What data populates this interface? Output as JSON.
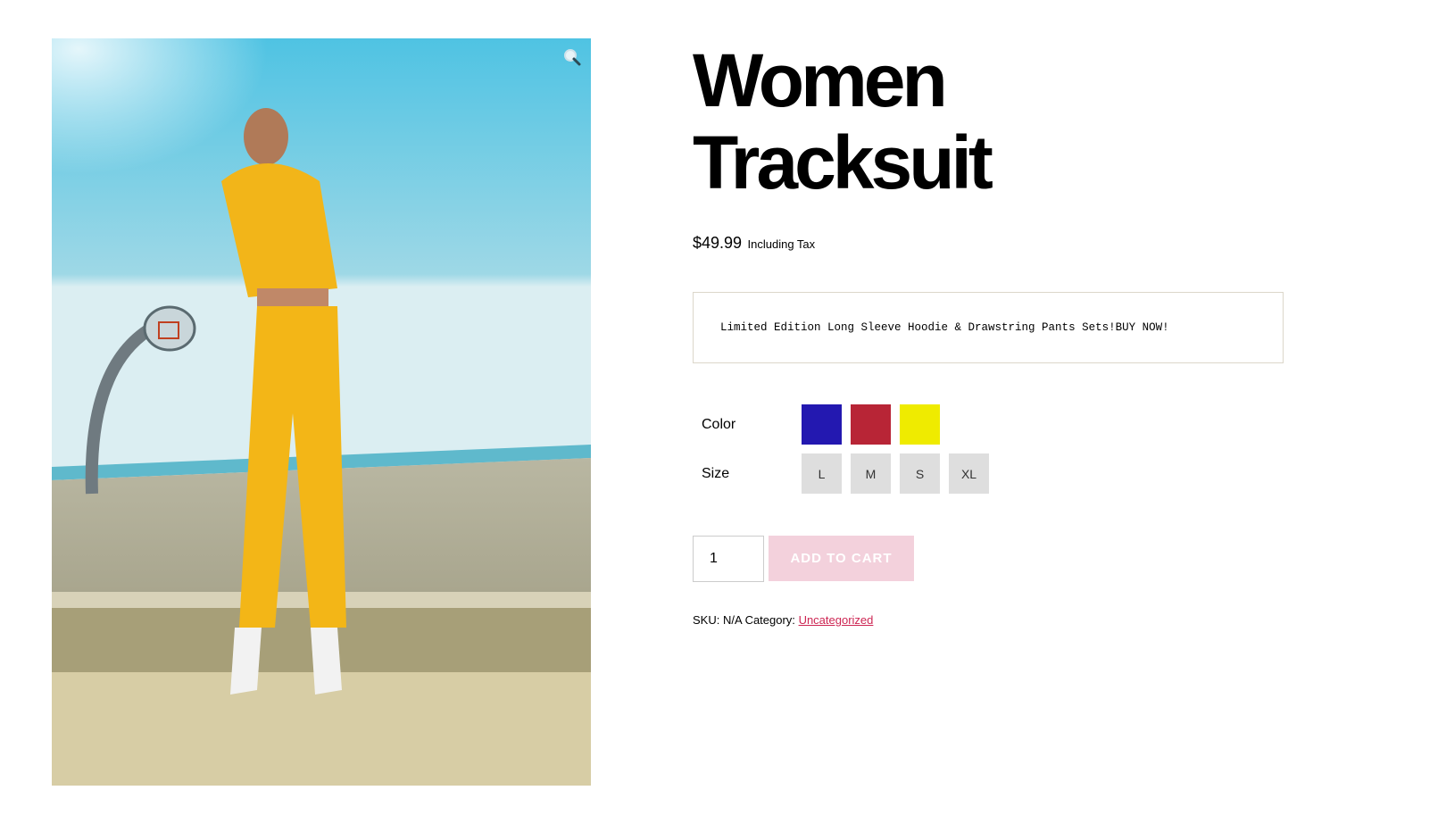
{
  "product": {
    "title_line1": "Women",
    "title_line2": "Tracksuit",
    "price": "$49.99",
    "price_suffix": "Including Tax",
    "short_description": "Limited Edition Long Sleeve Hoodie & Drawstring Pants Sets!BUY NOW!",
    "image_alt": "Woman wearing yellow cropped hoodie and drawstring pants near basketball hoop",
    "zoom_icon": "magnifier-icon"
  },
  "variations": {
    "color_label": "Color",
    "colors": [
      {
        "name": "Blue",
        "hex": "#2318b0"
      },
      {
        "name": "Red",
        "hex": "#b82536"
      },
      {
        "name": "Yellow",
        "hex": "#efeb00"
      }
    ],
    "size_label": "Size",
    "sizes": [
      "L",
      "M",
      "S",
      "XL"
    ]
  },
  "cart": {
    "quantity": "1",
    "add_to_cart_label": "ADD TO CART"
  },
  "meta": {
    "sku_label": "SKU:",
    "sku_value": "N/A",
    "category_label": "Category:",
    "category_link": "Uncategorized"
  }
}
